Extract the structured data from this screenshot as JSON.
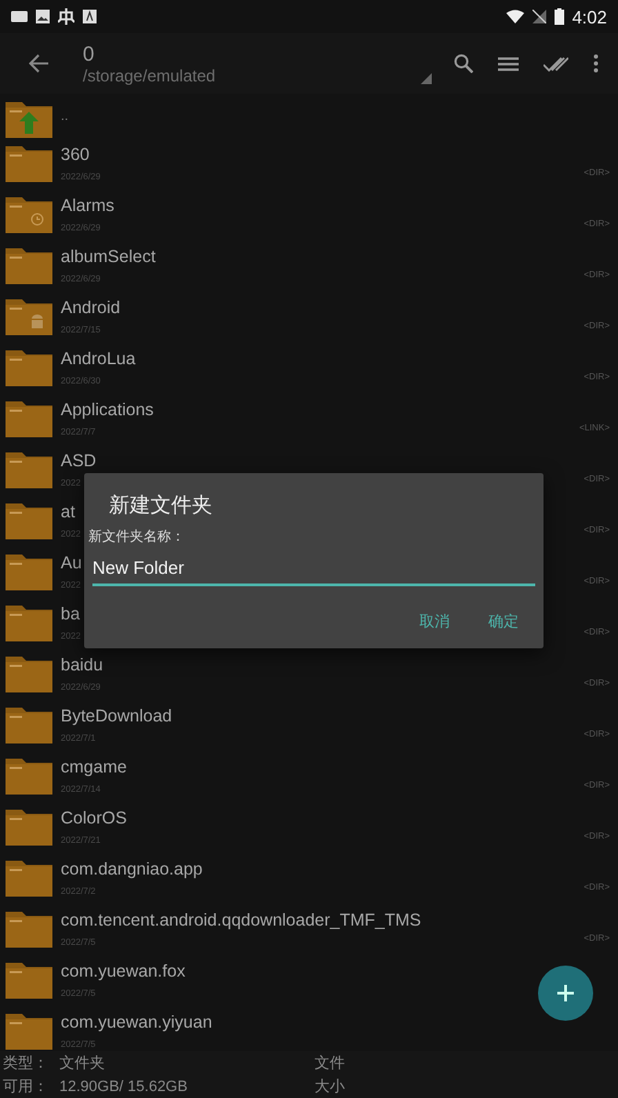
{
  "status_bar": {
    "time": "4:02"
  },
  "toolbar": {
    "title": "0",
    "path": "/storage/emulated"
  },
  "parent_row": {
    "name": ".."
  },
  "files": [
    {
      "name": "360",
      "date": "2022/6/29",
      "tag": "<DIR>",
      "kind": "folder"
    },
    {
      "name": "Alarms",
      "date": "2022/6/29",
      "tag": "<DIR>",
      "kind": "alarms"
    },
    {
      "name": "albumSelect",
      "date": "2022/6/29",
      "tag": "<DIR>",
      "kind": "folder"
    },
    {
      "name": "Android",
      "date": "2022/7/15",
      "tag": "<DIR>",
      "kind": "android"
    },
    {
      "name": "AndroLua",
      "date": "2022/6/30",
      "tag": "<DIR>",
      "kind": "folder"
    },
    {
      "name": "Applications",
      "date": "2022/7/7",
      "tag": "<LINK>",
      "kind": "folder"
    },
    {
      "name": "ASD",
      "date": "2022",
      "tag": "<DIR>",
      "kind": "folder"
    },
    {
      "name": "at",
      "date": "2022",
      "tag": "<DIR>",
      "kind": "folder"
    },
    {
      "name": "Au",
      "date": "2022",
      "tag": "<DIR>",
      "kind": "folder"
    },
    {
      "name": "ba",
      "date": "2022",
      "tag": "<DIR>",
      "kind": "folder"
    },
    {
      "name": "baidu",
      "date": "2022/6/29",
      "tag": "<DIR>",
      "kind": "folder"
    },
    {
      "name": "ByteDownload",
      "date": "2022/7/1",
      "tag": "<DIR>",
      "kind": "folder"
    },
    {
      "name": "cmgame",
      "date": "2022/7/14",
      "tag": "<DIR>",
      "kind": "folder"
    },
    {
      "name": "ColorOS",
      "date": "2022/7/21",
      "tag": "<DIR>",
      "kind": "folder"
    },
    {
      "name": "com.dangniao.app",
      "date": "2022/7/2",
      "tag": "<DIR>",
      "kind": "folder"
    },
    {
      "name": "com.tencent.android.qqdownloader_TMF_TMS",
      "date": "2022/7/5",
      "tag": "<DIR>",
      "kind": "folder"
    },
    {
      "name": "com.yuewan.fox",
      "date": "2022/7/5",
      "kind": "folder"
    },
    {
      "name": "com.yuewan.yiyuan",
      "date": "2022/7/5",
      "kind": "folder"
    }
  ],
  "dialog": {
    "title": "新建文件夹",
    "label": "新文件夹名称：",
    "value": "New Folder",
    "buttons": [
      "取消",
      "确定"
    ]
  },
  "info_bar": [
    {
      "label": "类型：",
      "value": "文件夹",
      "right": "文件"
    },
    {
      "label": "可用：",
      "value": "12.90GB/ 15.62GB",
      "right": "大小"
    }
  ]
}
